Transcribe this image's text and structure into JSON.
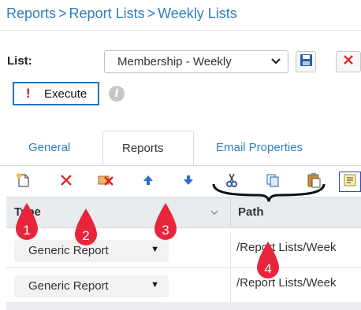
{
  "breadcrumb": [
    "Reports",
    "Report Lists",
    "Weekly Lists"
  ],
  "breadcrumb_separator": ">",
  "list": {
    "label": "List:",
    "selected": "Membership - Weekly"
  },
  "execute": {
    "label": "Execute",
    "icon": "exclamation-icon"
  },
  "info_glyph": "i",
  "tabs": [
    {
      "label": "General",
      "active": false
    },
    {
      "label": "Reports",
      "active": true
    },
    {
      "label": "Email Properties",
      "active": false
    }
  ],
  "toolbar": [
    "new-item-icon",
    "delete-icon",
    "remove-icon",
    "move-up-icon",
    "move-down-icon",
    "cut-icon",
    "copy-icon",
    "paste-icon",
    "properties-icon"
  ],
  "grid": {
    "columns": [
      "Type",
      "Path"
    ],
    "rows": [
      {
        "type": "Generic Report",
        "path": "/Report Lists/Week"
      },
      {
        "type": "Generic Report",
        "path": "/Report Lists/Week"
      }
    ]
  },
  "callouts": [
    "1",
    "2",
    "3",
    "4"
  ],
  "colors": {
    "link": "#2f7fc4",
    "callout": "#e8253a",
    "execute_border": "#1e74c6"
  }
}
